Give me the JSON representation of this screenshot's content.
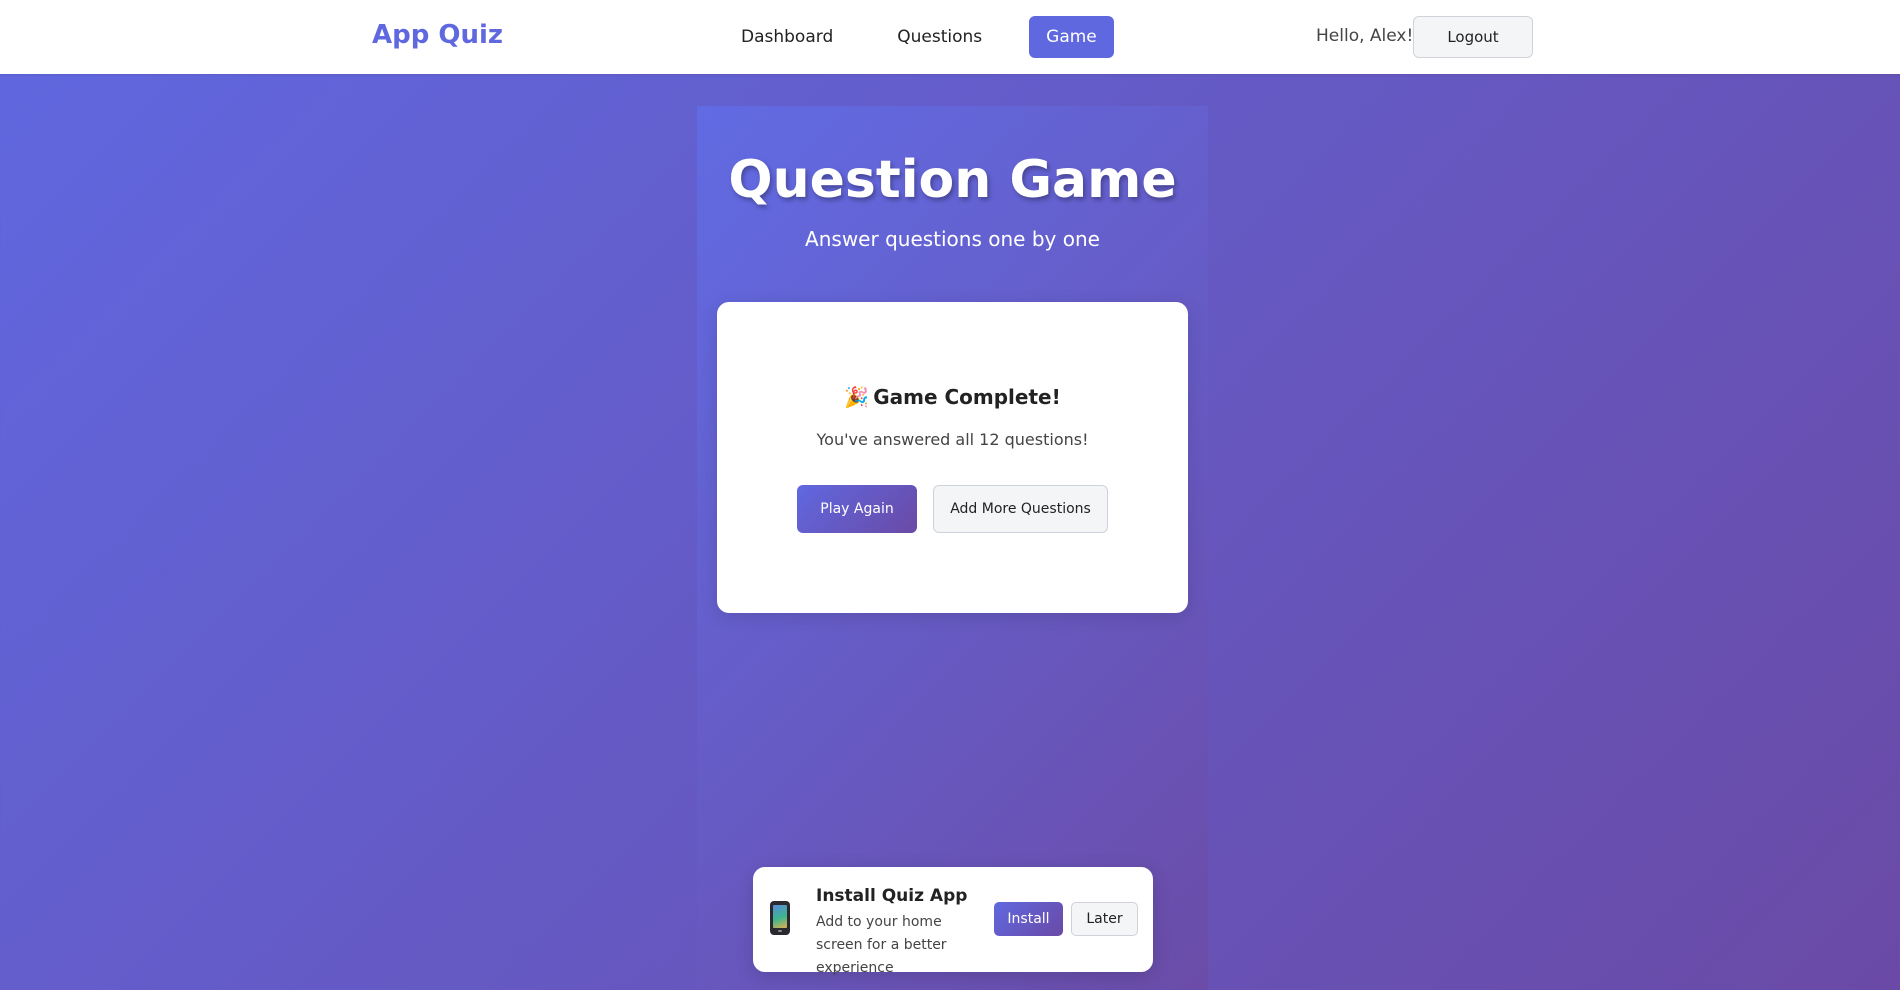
{
  "navbar": {
    "logo": "App Quiz",
    "links": [
      {
        "label": "Dashboard",
        "active": false
      },
      {
        "label": "Questions",
        "active": false
      },
      {
        "label": "Game",
        "active": true
      }
    ],
    "greeting": "Hello, Alex!",
    "logout_label": "Logout"
  },
  "page": {
    "title": "Question Game",
    "subtitle": "Answer questions one by one"
  },
  "result_card": {
    "icon": "party-popper-icon",
    "heading": "Game Complete!",
    "message": "You've answered all 12 questions!",
    "play_again_label": "Play Again",
    "add_more_label": "Add More Questions"
  },
  "install_banner": {
    "icon": "mobile-phone-icon",
    "title": "Install Quiz App",
    "description": "Add to your home screen for a better experience",
    "install_label": "Install",
    "later_label": "Later"
  },
  "colors": {
    "accent": "#6068e0",
    "gradient_end": "#6a4aa6"
  }
}
